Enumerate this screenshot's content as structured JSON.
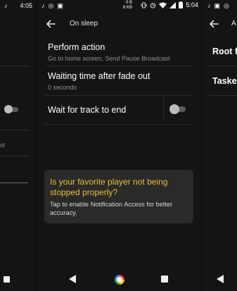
{
  "left_panel": {
    "status_time": "4:05",
    "fragment_text": "st",
    "icons": [
      "music-note-icon",
      "square-nav-icon"
    ]
  },
  "center_panel": {
    "status_bar": {
      "left_glyphs": [
        "♪",
        "◎",
        "▣"
      ],
      "net_speed_top": "0 B",
      "net_speed_bottom": "6 KB",
      "time": "5:04",
      "icons": [
        "music-note-icon",
        "instagram-icon",
        "gallery-icon",
        "vibrate-icon",
        "alarm-icon",
        "wifi-icon",
        "signal-icon",
        "battery-icon"
      ]
    },
    "header": {
      "title": "On sleep"
    },
    "settings": [
      {
        "title": "Perform action",
        "subtitle": "Go to home screen, Send Pause Broadcast"
      },
      {
        "title": "Waiting time after fade out",
        "subtitle": "0 seconds"
      },
      {
        "title": "Wait for track to end",
        "toggle_on": false
      }
    ],
    "banner": {
      "title": "Is your favorite player not being stopped properly?",
      "body": "Tap to enable Notification Access for better accuracy.",
      "title_color": "#e9bf32"
    },
    "nav_bar": {
      "icons": [
        "back-icon",
        "home-icon",
        "recents-icon"
      ]
    }
  },
  "right_panel": {
    "status_glyphs": [
      "♪",
      "▣",
      "◎"
    ],
    "header_title_fragment": "A",
    "items": [
      "Root fu",
      "Tasker"
    ]
  },
  "colors": {
    "background": "#141414",
    "accent": "#e9bf32",
    "banner_bg": "#2a2a2a",
    "secondary_text": "#8e8e8e"
  }
}
